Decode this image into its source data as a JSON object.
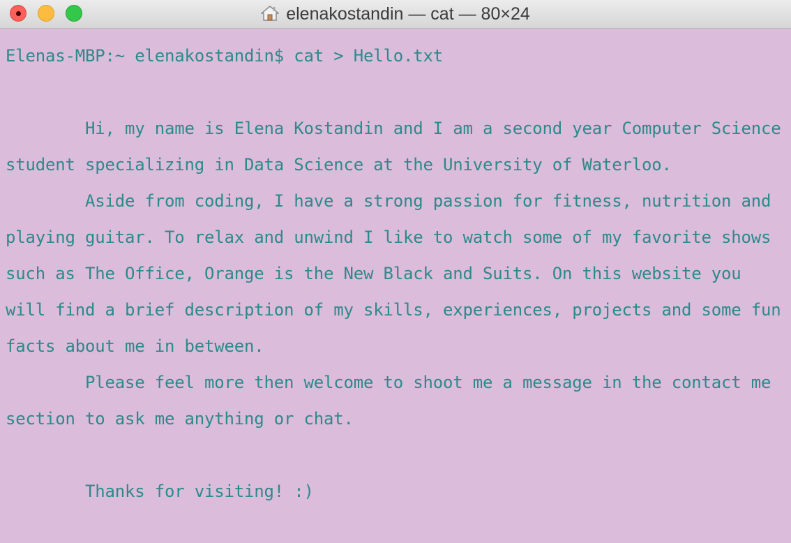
{
  "window": {
    "title": "elenakostandin — cat — 80×24",
    "title_icon": "home-icon"
  },
  "terminal": {
    "lines": [
      "Elenas-MBP:~ elenakostandin$ cat > Hello.txt",
      "",
      "        Hi, my name is Elena Kostandin and I am a second year Computer Science",
      "student specializing in Data Science at the University of Waterloo.",
      "        Aside from coding, I have a strong passion for fitness, nutrition and",
      "playing guitar. To relax and unwind I like to watch some of my favorite shows",
      "such as The Office, Orange is the New Black and Suits. On this website you",
      "will find a brief description of my skills, experiences, projects and some fun",
      "facts about me in between.",
      "        Please feel more then welcome to shoot me a message in the contact me",
      "section to ask me anything or chat.",
      "",
      "        Thanks for visiting! :)"
    ]
  },
  "colors": {
    "background": "#dcbcdb",
    "text": "#2b8a8a",
    "close": "#fc605c",
    "minimize": "#fdbc40",
    "zoom": "#34c84a"
  }
}
